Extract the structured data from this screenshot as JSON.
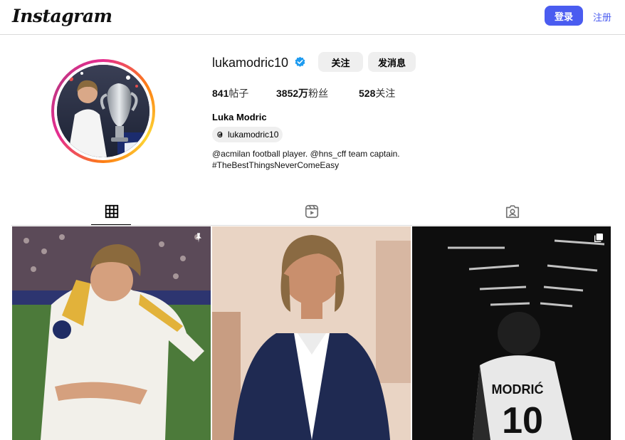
{
  "header": {
    "logo": "Instagram",
    "login_label": "登录",
    "register_label": "注册"
  },
  "profile": {
    "username": "lukamodric10",
    "follow_label": "关注",
    "message_label": "发消息",
    "stats": [
      {
        "value": "841",
        "label": "帖子"
      },
      {
        "value": "3852万",
        "label": "粉丝"
      },
      {
        "value": "528",
        "label": "关注"
      }
    ],
    "full_name": "Luka Modric",
    "threads_handle": "lukamodric10",
    "bio_line1": "@acmilan football player. @hns_cff team captain.",
    "bio_line2": "#TheBestThingsNeverComeEasy"
  },
  "tabs": [
    {
      "name": "posts",
      "icon": "grid-icon",
      "active": true
    },
    {
      "name": "reels",
      "icon": "reels-icon",
      "active": false
    },
    {
      "name": "tagged",
      "icon": "tagged-icon",
      "active": false
    }
  ],
  "posts": [
    {
      "badge": "pin-icon"
    },
    {
      "badge": ""
    },
    {
      "badge": "carousel-icon"
    }
  ],
  "colors": {
    "accent": "#4a5cf0",
    "verified": "#1d9bf0",
    "border": "#dbdbdb",
    "button_gray": "#efefef"
  }
}
